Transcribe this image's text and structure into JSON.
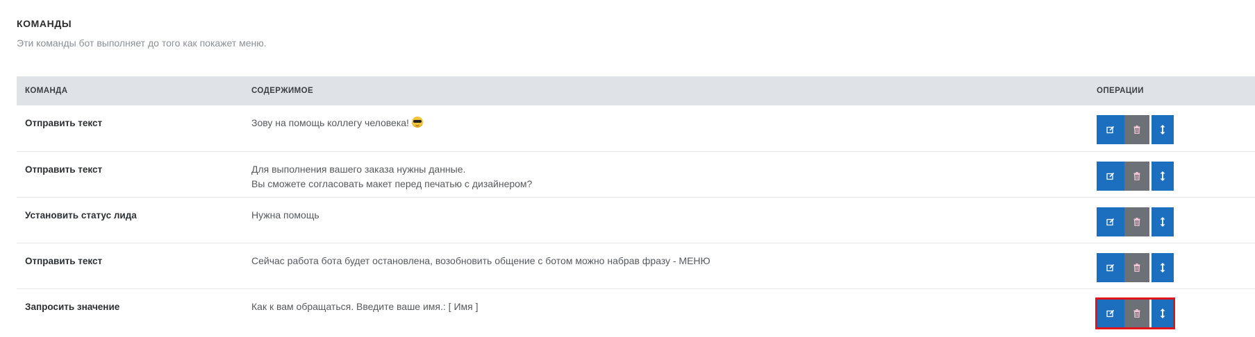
{
  "section": {
    "title": "КОМАНДЫ",
    "subtitle": "Эти команды бот выполняет до того как покажет меню."
  },
  "table": {
    "headers": {
      "command": "КОМАНДА",
      "content": "СОДЕРЖИМОЕ",
      "operations": "ОПЕРАЦИИ"
    },
    "rows": [
      {
        "command": "Отправить текст",
        "content": [
          "Зову на помощь коллегу человека!"
        ],
        "emoji": "sunglasses-emoji-icon"
      },
      {
        "command": "Отправить текст",
        "content": [
          "Для выполнения вашего заказа нужны данные.",
          "Вы сможете согласовать макет перед печатью с дизайнером?"
        ]
      },
      {
        "command": "Установить статус лида",
        "content": [
          "Нужна помощь"
        ]
      },
      {
        "command": "Отправить текст",
        "content": [
          "Сейчас работа бота будет остановлена, возобновить общение с ботом можно набрав фразу - МЕНЮ"
        ]
      },
      {
        "command": "Запросить значение",
        "content": [
          "Как к вам обращаться. Введите ваше имя.: [ Имя ]"
        ],
        "selected": true
      }
    ]
  },
  "colors": {
    "primary_button": "#1b6fbe",
    "delete_button": "#6c7178",
    "header_background": "#dfe2e6",
    "highlight_outline": "#e0141c"
  },
  "icons": {
    "edit": "edit-icon",
    "delete": "trash-icon",
    "move": "arrows-vertical-icon"
  }
}
